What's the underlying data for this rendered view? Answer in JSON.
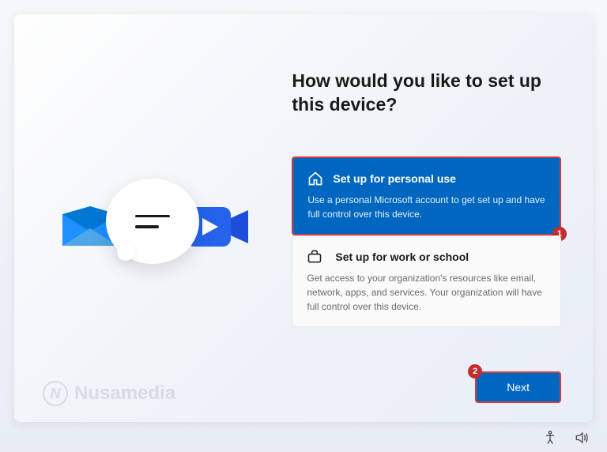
{
  "heading": "How would you like to set up this device?",
  "options": {
    "personal": {
      "title": "Set up for personal use",
      "description": "Use a personal Microsoft account to get set up and have full control over this device."
    },
    "work": {
      "title": "Set up for work or school",
      "description": "Get access to your organization's resources like email, network, apps, and services. Your organization will have full control over this device."
    }
  },
  "next_button": "Next",
  "annotations": {
    "badge1": "1",
    "badge2": "2"
  },
  "watermark": {
    "logo_letter": "N",
    "text": "Nusamedia"
  }
}
